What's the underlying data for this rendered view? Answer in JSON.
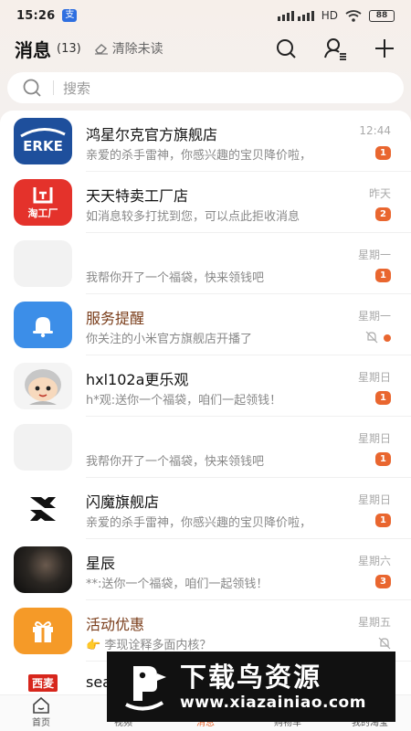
{
  "status": {
    "time": "15:26",
    "notif_icon_text": "支",
    "network_label": "HD",
    "battery": "88"
  },
  "header": {
    "title": "消息",
    "count": "(13)",
    "clear_label": "清除未读"
  },
  "search": {
    "placeholder": "搜索"
  },
  "conversations": [
    {
      "name": "鸿星尔克官方旗舰店",
      "preview": "亲爱的杀手雷神，你感兴趣的宝贝降价啦，",
      "time": "12:44",
      "badge": "1"
    },
    {
      "name": "天天特卖工厂店",
      "preview": "如消息较多打扰到您，可以点此拒收消息",
      "time": "昨天",
      "badge": "2",
      "avatar_text": "淘工厂"
    },
    {
      "name": "",
      "preview": "我帮你开了一个福袋，快来领钱吧",
      "time": "星期一",
      "badge": "1"
    },
    {
      "name": "服务提醒",
      "preview": "你关注的小米官方旗舰店开播了",
      "time": "星期一",
      "badge": ""
    },
    {
      "name": "hxl102a更乐观",
      "preview": "h*观:送你一个福袋，咱们一起领钱！",
      "time": "星期日",
      "badge": "1"
    },
    {
      "name": "",
      "preview": "我帮你开了一个福袋，快来领钱吧",
      "time": "星期日",
      "badge": "1"
    },
    {
      "name": "闪魔旗舰店",
      "preview": "亲爱的杀手雷神，你感兴趣的宝贝降价啦，",
      "time": "星期日",
      "badge": "1"
    },
    {
      "name": "星辰",
      "preview": "**:送你一个福袋，咱们一起领钱！",
      "time": "星期六",
      "badge": "3"
    },
    {
      "name": "活动优惠",
      "preview": "👉 李现诠释多面内核？",
      "time": "星期五",
      "badge": ""
    },
    {
      "name": "sea",
      "preview": "",
      "time": "",
      "badge": "",
      "avatar_text": "西麦"
    }
  ],
  "brand": {
    "erke_text": "ERKE"
  },
  "tabs": [
    {
      "label": "首页"
    },
    {
      "label": "视频"
    },
    {
      "label": "消息"
    },
    {
      "label": "购物车"
    },
    {
      "label": "我的淘宝"
    }
  ],
  "watermark": {
    "title": "下载鸟资源",
    "url": "www.xiazainiao.com"
  },
  "colors": {
    "accent": "#e9662f",
    "erke_blue": "#1e4f9c",
    "tmall_red": "#e4322b",
    "service_blue": "#3c8ee8",
    "promo_orange": "#f59a28"
  }
}
